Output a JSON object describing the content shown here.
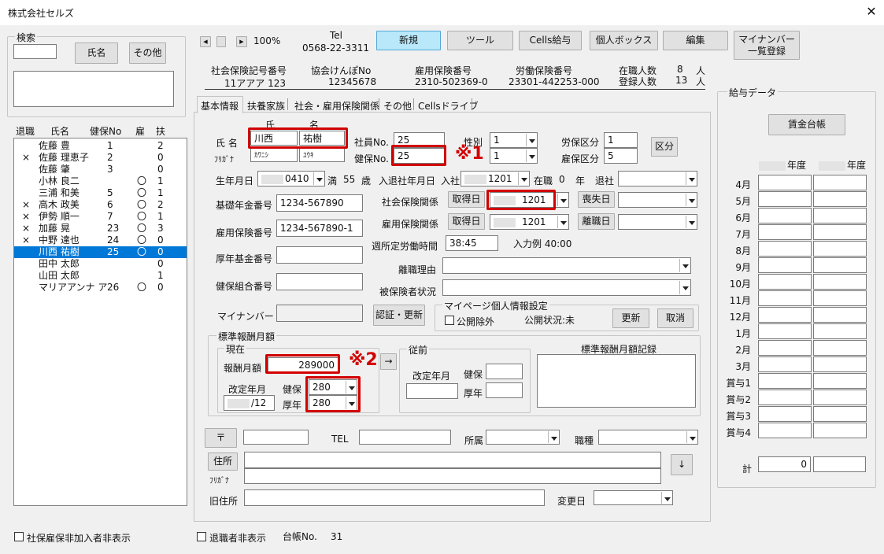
{
  "window": {
    "title": "株式会社セルズ"
  },
  "search": {
    "title": "検索",
    "name_btn": "氏名",
    "other_btn": "その他"
  },
  "emp_header": {
    "retire": "退職",
    "name": "氏名",
    "hoken": "健保No",
    "koyo": "雇",
    "fuyo": "扶"
  },
  "employees": [
    {
      "mark": "",
      "name": "佐藤 豊",
      "no": "1",
      "koyo": "",
      "fuyo": "2"
    },
    {
      "mark": "×",
      "name": "佐藤 理恵子",
      "no": "2",
      "koyo": "",
      "fuyo": "0"
    },
    {
      "mark": "",
      "name": "佐藤 肇",
      "no": "3",
      "koyo": "",
      "fuyo": "0"
    },
    {
      "mark": "",
      "name": "小林 良二",
      "no": "",
      "koyo": "〇",
      "fuyo": "1"
    },
    {
      "mark": "",
      "name": "三浦 和美",
      "no": "5",
      "koyo": "〇",
      "fuyo": "1"
    },
    {
      "mark": "×",
      "name": "高木 政美",
      "no": "6",
      "koyo": "〇",
      "fuyo": "2"
    },
    {
      "mark": "×",
      "name": "伊勢 順一",
      "no": "7",
      "koyo": "〇",
      "fuyo": "1"
    },
    {
      "mark": "×",
      "name": "加藤 晃",
      "no": "23",
      "koyo": "〇",
      "fuyo": "3"
    },
    {
      "mark": "×",
      "name": "中野 達也",
      "no": "24",
      "koyo": "〇",
      "fuyo": "0"
    },
    {
      "mark": "",
      "name": "川西 祐樹",
      "no": "25",
      "koyo": "〇",
      "fuyo": "0"
    },
    {
      "mark": "",
      "name": "田中 太郎",
      "no": "",
      "koyo": "",
      "fuyo": "0"
    },
    {
      "mark": "",
      "name": "山田 太郎",
      "no": "",
      "koyo": "",
      "fuyo": "1"
    },
    {
      "mark": "",
      "name": "マリアアンナ アウ(",
      "no": "26",
      "koyo": "〇",
      "fuyo": "0"
    }
  ],
  "hide_uninsured": "社保雇保非加入者非表示",
  "hide_retired": "退職者非表示",
  "ledger": {
    "label": "台帳No.",
    "value": "31"
  },
  "toolbar": {
    "zoom": "100%",
    "tel_label": "Tel",
    "tel": "0568-22-3311",
    "new": "新規",
    "tools": "ツール",
    "cells_pay": "Cells給与",
    "personal_box": "個人ボックス",
    "edit": "編集",
    "mynumber": "マイナンバー\n一覧登録"
  },
  "company": {
    "shaho_label": "社会保険記号番号",
    "shaho": "11アアア 123",
    "kenpo_label": "協会けんぽNo",
    "kenpo": "12345678",
    "koyo_label": "雇用保険番号",
    "koyo": "2310-502369-0",
    "rodo_label": "労働保険番号",
    "rodo": "23301-442253-000",
    "zaishoku_label": "在職人数",
    "zaishoku": "8",
    "toroku_label": "登録人数",
    "toroku": "13",
    "nin": "人"
  },
  "tabs": [
    "基本情報",
    "扶養家族",
    "社会・雇用保険関係",
    "その他",
    "Cellsドライブ"
  ],
  "form": {
    "shi": "氏",
    "mei": "名",
    "name_label": "氏 名",
    "furigana_label": "ﾌﾘｶﾞﾅ",
    "last_name": "川西",
    "first_name": "祐樹",
    "last_kana": "ｶﾜﾆｼ",
    "first_kana": "ﾕｳｷ",
    "emp_no_label": "社員No.",
    "emp_no": "25",
    "kenpo_no_label": "健保No.",
    "kenpo_no": "25",
    "gender_label": "性別",
    "gender": "1",
    "seibetsu2": "1",
    "roho_label": "労保区分",
    "roho": "1",
    "koho_label": "雇保区分",
    "koho": "5",
    "kubun_btn": "区分",
    "birth_label": "生年月日",
    "birth": "0410",
    "age_pre": "満",
    "age": "55",
    "age_unit": "歳",
    "entry_label": "入退社年月日",
    "nyusha": "入社",
    "entry": "1201",
    "zaishoku": "在職",
    "years": "0",
    "nen": "年",
    "taisha": "退社",
    "kiso_label": "基礎年金番号",
    "kiso": "1234-567890",
    "koyo_label": "雇用保険番号",
    "koyo": "1234-567890-1",
    "kosei_label": "厚年基金番号",
    "kenko_label": "健保組合番号",
    "mynumber_label": "マイナンバー",
    "shaho_rel_label": "社会保険関係",
    "get_btn": "取得日",
    "shaho_get": "1201",
    "lose_btn": "喪失日",
    "koyo_rel_label": "雇用保険関係",
    "koyo_get": "1201",
    "leave_btn": "離職日",
    "work_hours_label": "週所定労働時間",
    "work_hours": "38:45",
    "example": "入力例 40:00",
    "leave_reason_label": "離職理由",
    "insured_status_label": "被保険者状況",
    "auth_btn": "認証・更新",
    "mypage_title": "マイページ個人情報設定",
    "public_excl": "公開除外",
    "public_status": "公開状況:未",
    "update_btn": "更新",
    "cancel_btn": "取消"
  },
  "standard": {
    "title": "標準報酬月額",
    "current": "現在",
    "monthly_label": "報酬月額",
    "monthly": "289000",
    "kaitei_label": "改定年月",
    "kaitei": "/12",
    "kenpo_label": "健保",
    "kenpo": "280",
    "kosei_label": "厚年",
    "kosei": "280",
    "arrow": "→",
    "prev": "従前",
    "prev_kaitei": "改定年月",
    "prev_kenpo": "健保",
    "prev_kosei": "厚年",
    "record": "標準報酬月額記録"
  },
  "notes": {
    "n1": "※1",
    "n2": "※2"
  },
  "address": {
    "zip_btn": "〒",
    "tel": "TEL",
    "dept": "所属",
    "job": "職種",
    "addr_btn": "住所",
    "furigana": "ﾌﾘｶﾞﾅ",
    "old": "旧住所",
    "change_date": "変更日",
    "down": "↓"
  },
  "salary": {
    "title": "給与データ",
    "ledger_btn": "賃金台帳",
    "year": "年度",
    "months": [
      "4月",
      "5月",
      "6月",
      "7月",
      "8月",
      "9月",
      "10月",
      "11月",
      "12月",
      "1月",
      "2月",
      "3月",
      "賞与1",
      "賞与2",
      "賞与3",
      "賞与4"
    ],
    "total_label": "計",
    "total": "0"
  }
}
